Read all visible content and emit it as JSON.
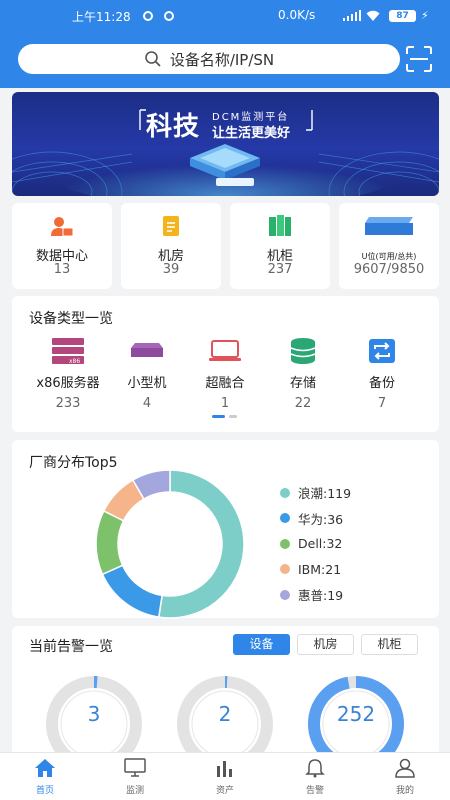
{
  "status_bar": {
    "time": "上午11:28",
    "network_speed": "0.0K/s",
    "battery": "87"
  },
  "search": {
    "placeholder": "设备名称/IP/SN"
  },
  "banner": {
    "headline": "科技",
    "platform": "DCM监测平台",
    "slogan": "让生活更美好"
  },
  "stats": [
    {
      "label": "数据中心",
      "value": "13",
      "icon": "datacenter-icon",
      "color": "#f06b35"
    },
    {
      "label": "机房",
      "value": "39",
      "icon": "room-icon",
      "color": "#f5b31c"
    },
    {
      "label": "机柜",
      "value": "237",
      "icon": "cabinet-icon",
      "color": "#29b16b"
    },
    {
      "label": "U位(可用/总共)",
      "value": "9607/9850",
      "icon": "u-position-icon",
      "color": "#2e7ad6"
    }
  ],
  "device_types": {
    "title": "设备类型一览",
    "items": [
      {
        "label": "x86服务器",
        "value": "233",
        "icon": "x86-server-icon",
        "color": "#b2467d"
      },
      {
        "label": "小型机",
        "value": "4",
        "icon": "minicomputer-icon",
        "color": "#8e4a9e"
      },
      {
        "label": "超融合",
        "value": "1",
        "icon": "hyperconverged-icon",
        "color": "#e2525a"
      },
      {
        "label": "存储",
        "value": "22",
        "icon": "storage-icon",
        "color": "#2aa775"
      },
      {
        "label": "备份",
        "value": "7",
        "icon": "backup-icon",
        "color": "#2f86e8"
      }
    ]
  },
  "vendor": {
    "title": "厂商分布Top5",
    "legend": [
      "浪潮:119",
      "华为:36",
      "Dell:32",
      "IBM:21",
      "惠普:19"
    ]
  },
  "chart_data": {
    "type": "pie",
    "title": "厂商分布Top5",
    "categories": [
      "浪潮",
      "华为",
      "Dell",
      "IBM",
      "惠普"
    ],
    "values": [
      119,
      36,
      32,
      21,
      19
    ],
    "colors": [
      "#7dcec8",
      "#3a9ae8",
      "#7ec16b",
      "#f5b48a",
      "#a4a6de"
    ],
    "legend_position": "right"
  },
  "alarms": {
    "title": "当前告警一览",
    "tabs": [
      "设备",
      "机房",
      "机柜"
    ],
    "active_tab": 0,
    "gauges": [
      {
        "value": "3",
        "fraction": 0.012
      },
      {
        "value": "2",
        "fraction": 0.008
      },
      {
        "value": "252",
        "fraction": 0.97
      }
    ]
  },
  "bottom_nav": [
    {
      "label": "首页",
      "icon": "home-icon",
      "active": true
    },
    {
      "label": "监测",
      "icon": "monitor-icon",
      "active": false
    },
    {
      "label": "资产",
      "icon": "assets-icon",
      "active": false
    },
    {
      "label": "告警",
      "icon": "bell-icon",
      "active": false
    },
    {
      "label": "我的",
      "icon": "user-icon",
      "active": false
    }
  ]
}
